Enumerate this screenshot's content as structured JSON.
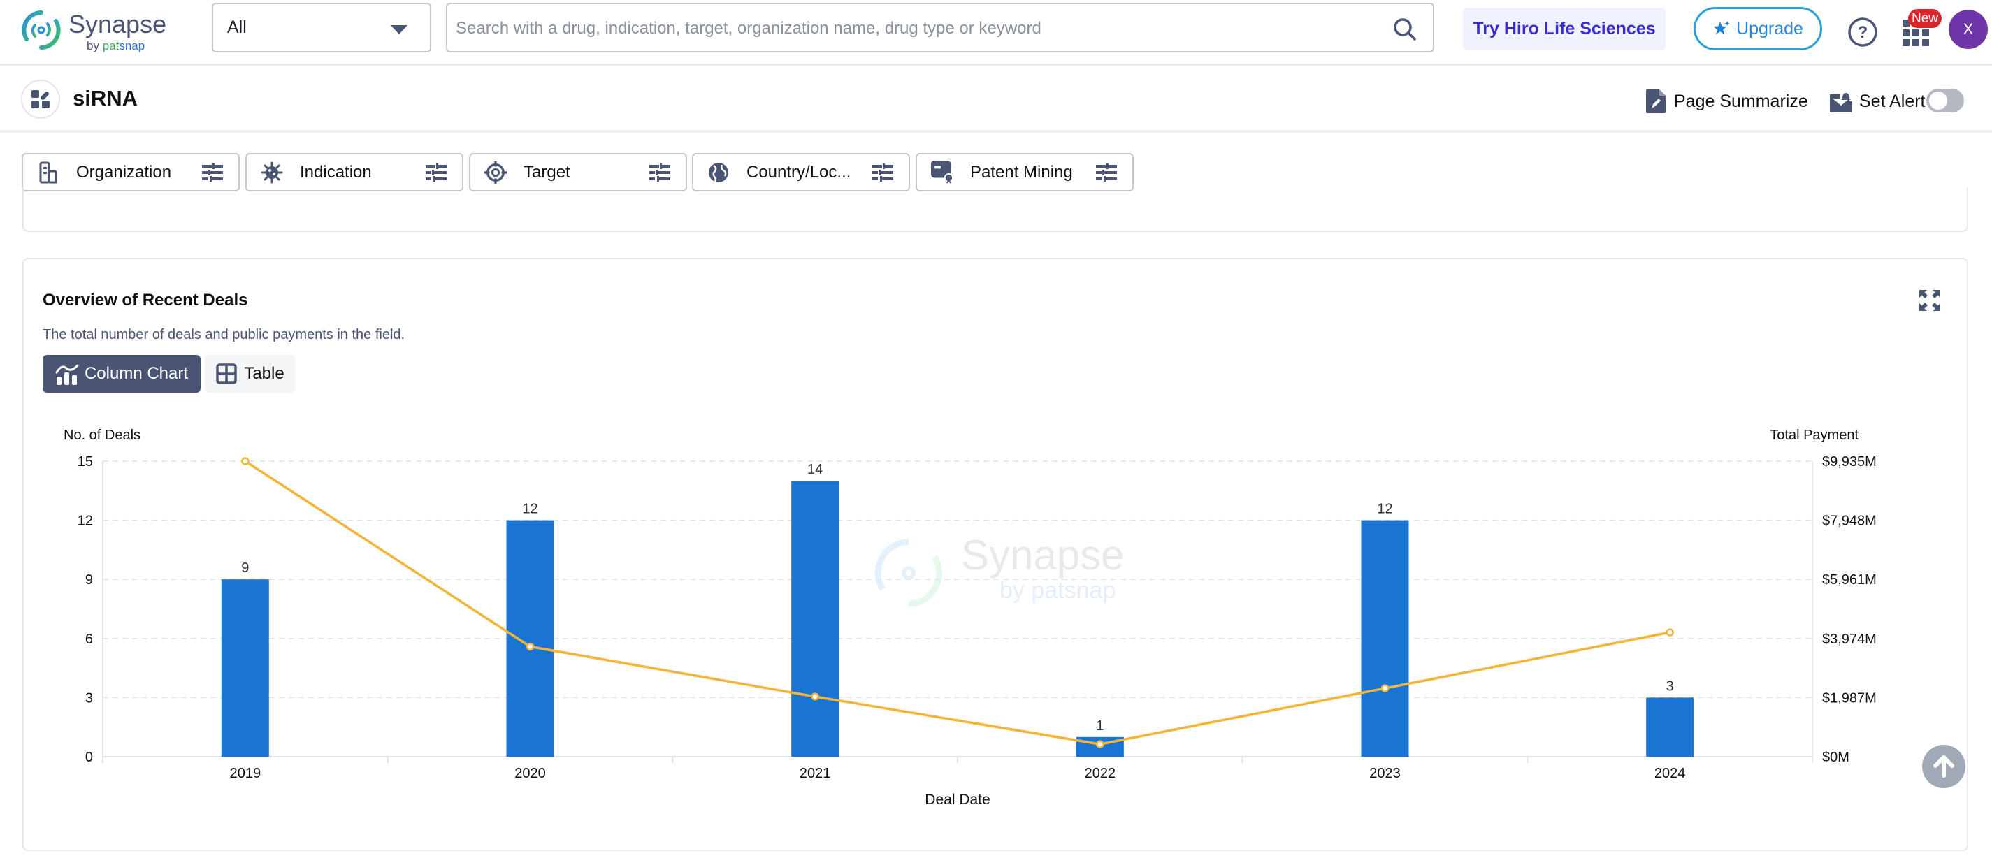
{
  "topbar": {
    "logo_word": "Synapse",
    "logo_by": "by ",
    "logo_pat": "pat",
    "logo_snap": "snap",
    "scope_select_value": "All",
    "search_placeholder": "Search with a drug, indication, target, organization name, drug type or keyword",
    "search_value": "",
    "hiro_label": "Try Hiro Life Sciences",
    "upgrade_label": "Upgrade",
    "new_badge": "New",
    "avatar_initial": "X"
  },
  "page_header": {
    "title": "siRNA",
    "summarize_label": "Page Summarize",
    "alert_label": "Set Alert",
    "alert_enabled": false
  },
  "filters": [
    {
      "label": "Organization",
      "icon": "building-icon"
    },
    {
      "label": "Indication",
      "icon": "virus-icon"
    },
    {
      "label": "Target",
      "icon": "target-icon"
    },
    {
      "label": "Country/Loc...",
      "icon": "globe-icon"
    },
    {
      "label": "Patent Mining",
      "icon": "patent-icon"
    }
  ],
  "deals_card": {
    "title": "Overview of Recent Deals",
    "description": "The total number of deals and public payments in the field.",
    "view_buttons": {
      "chart": "Column Chart",
      "table": "Table"
    },
    "active_view": "chart",
    "watermark_word": "Synapse",
    "watermark_by": "by patsnap"
  },
  "colors": {
    "bar": "#1a75d2",
    "line": "#f2b53a",
    "accent_dark": "#4a5573"
  },
  "chart_data": {
    "type": "bar",
    "title": "Overview of Recent Deals",
    "xlabel": "Deal Date",
    "ylabel": "No. of Deals",
    "ylabel_right": "Total Payment",
    "categories": [
      "2019",
      "2020",
      "2021",
      "2022",
      "2023",
      "2024"
    ],
    "series": [
      {
        "name": "No. of Deals",
        "type": "bar",
        "axis": "left",
        "values": [
          9,
          12,
          14,
          1,
          12,
          3
        ],
        "data_labels": [
          "9",
          "12",
          "14",
          "1",
          "12",
          "3"
        ]
      },
      {
        "name": "Total Payment ($M)",
        "type": "line",
        "axis": "right",
        "values": [
          9935,
          3700,
          2020,
          420,
          2300,
          4180
        ]
      }
    ],
    "ylim": [
      0,
      15
    ],
    "yticks": [
      0,
      3,
      6,
      9,
      12,
      15
    ],
    "ytick_labels": [
      "0",
      "3",
      "6",
      "9",
      "12",
      "15"
    ],
    "ylim_right": [
      0,
      9935
    ],
    "yticks_right": [
      0,
      1987,
      3974,
      5961,
      7948,
      9935
    ],
    "ytick_labels_right": [
      "$0M",
      "$1,987M",
      "$3,974M",
      "$5,961M",
      "$7,948M",
      "$9,935M"
    ],
    "grid": true,
    "legend": "none"
  }
}
